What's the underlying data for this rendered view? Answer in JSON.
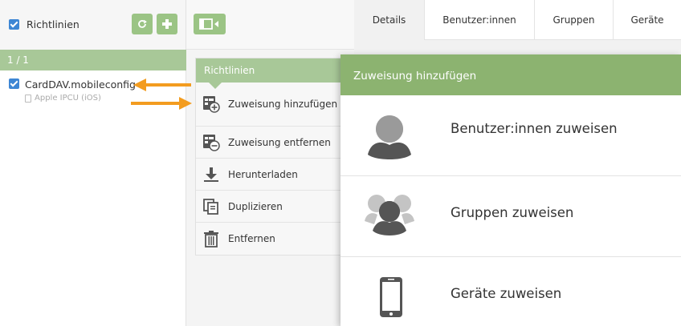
{
  "left": {
    "title": "Richtlinien",
    "pager": "1 / 1",
    "items": [
      {
        "name": "CardDAV.mobileconfig",
        "sub": "Apple IPCU (iOS)"
      }
    ]
  },
  "menu": {
    "title": "Richtlinien",
    "items": [
      {
        "label": "Zuweisung hinzufügen",
        "icon": "assign-add-icon"
      },
      {
        "label": "Zuweisung entfernen",
        "icon": "assign-remove-icon"
      },
      {
        "label": "Herunterladen",
        "icon": "download-icon"
      },
      {
        "label": "Duplizieren",
        "icon": "duplicate-icon"
      },
      {
        "label": "Entfernen",
        "icon": "trash-icon"
      }
    ]
  },
  "tabs": [
    "Details",
    "Benutzer:innen",
    "Gruppen",
    "Geräte"
  ],
  "panel": {
    "title": "Zuweisung hinzufügen",
    "options": [
      {
        "label": "Benutzer:innen zuweisen",
        "icon": "user-icon"
      },
      {
        "label": "Gruppen zuweisen",
        "icon": "group-icon"
      },
      {
        "label": "Geräte zuweisen",
        "icon": "smartphone-icon"
      }
    ]
  },
  "colors": {
    "accent_green": "#8cb370",
    "light_green": "#a8c898",
    "checkbox_blue": "#3d86d4",
    "arrow_orange": "#f39c1f"
  }
}
